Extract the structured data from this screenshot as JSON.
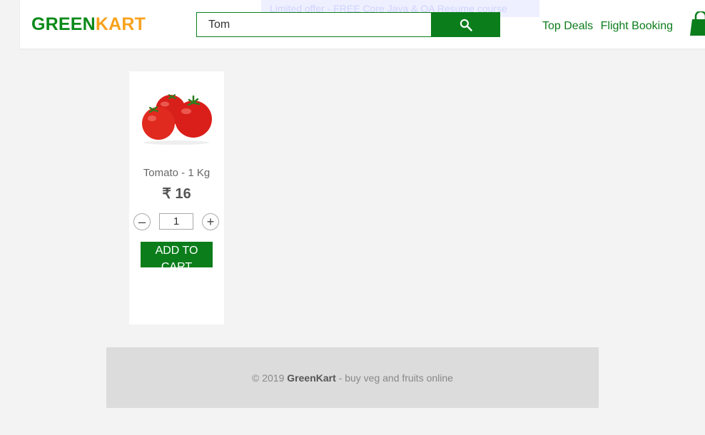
{
  "header": {
    "logo_part1": "GREEN",
    "logo_part2": "KART",
    "promo_text": "Limited offer - FREE Core Java & QA Resume course",
    "search": {
      "value": "Tom",
      "icon": "search-icon"
    },
    "nav": [
      "Top Deals",
      "Flight Booking"
    ],
    "cart_icon": "shopping-bag-icon"
  },
  "product": {
    "name": "Tomato - 1 Kg",
    "price": "₹ 16",
    "quantity": "1",
    "minus_label": "–",
    "plus_label": "+",
    "add_label": "ADD TO CART"
  },
  "footer": {
    "prefix": "© 2019 ",
    "brand": "GreenKart",
    "suffix": " - buy veg and fruits online"
  },
  "colors": {
    "brand_green": "#0b7d1b",
    "brand_orange": "#f8a21e",
    "background": "#f3f3f3",
    "footer_bg": "#dcdcdc"
  }
}
